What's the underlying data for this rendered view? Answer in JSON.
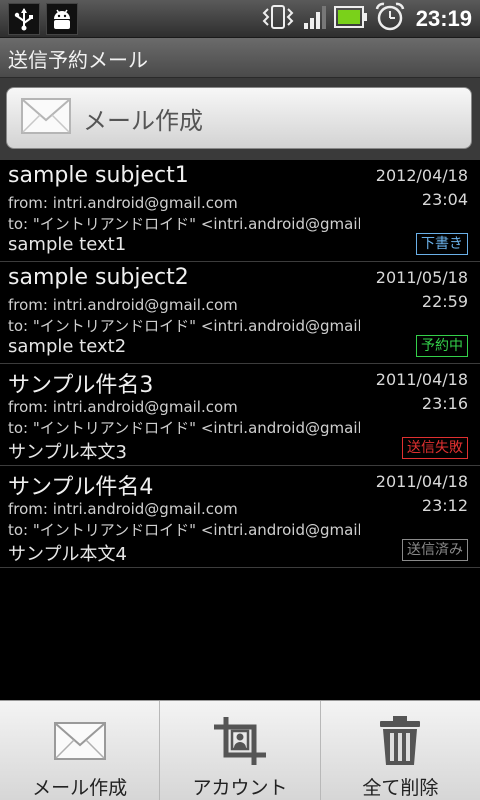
{
  "status_bar": {
    "clock": "23:19",
    "left_icons": [
      "usb-icon",
      "android-debug-icon"
    ],
    "right_icons": [
      "vibrate-icon",
      "signal-icon",
      "battery-icon",
      "alarm-icon"
    ]
  },
  "title_bar": {
    "title": "送信予約メール"
  },
  "compose": {
    "label": "メール作成",
    "icon": "envelope-icon"
  },
  "mails": [
    {
      "subject": "sample subject1",
      "from": "from: intri.android@gmail.com",
      "to": "to: \"イントリアンドロイド\" <intri.android@gmail.",
      "body": "sample text1",
      "date": "2012/04/18",
      "time": "23:04",
      "status": "下書き",
      "status_color": "#6ab0e8"
    },
    {
      "subject": "sample subject2",
      "from": "from: intri.android@gmail.com",
      "to": "to: \"イントリアンドロイド\" <intri.android@gmail.",
      "body": "sample text2",
      "date": "2011/05/18",
      "time": "22:59",
      "status": "予約中",
      "status_color": "#34d04a"
    },
    {
      "subject": "サンプル件名3",
      "from": "from: intri.android@gmail.com",
      "to": "to: \"イントリアンドロイド\" <intri.android@gmail.",
      "body": "サンプル本文3",
      "date": "2011/04/18",
      "time": "23:16",
      "status": "送信失敗",
      "status_color": "#e03030"
    },
    {
      "subject": "サンプル件名4",
      "from": "from: intri.android@gmail.com",
      "to": "to: \"イントリアンドロイド\" <intri.android@gmail.",
      "body": "サンプル本文4",
      "date": "2011/04/18",
      "time": "23:12",
      "status": "送信済み",
      "status_color": "#8a8a8a"
    }
  ],
  "menu": {
    "items": [
      {
        "label": "メール作成",
        "icon": "envelope-icon"
      },
      {
        "label": "アカウント",
        "icon": "account-crop-icon"
      },
      {
        "label": "全て削除",
        "icon": "trash-icon"
      }
    ]
  }
}
